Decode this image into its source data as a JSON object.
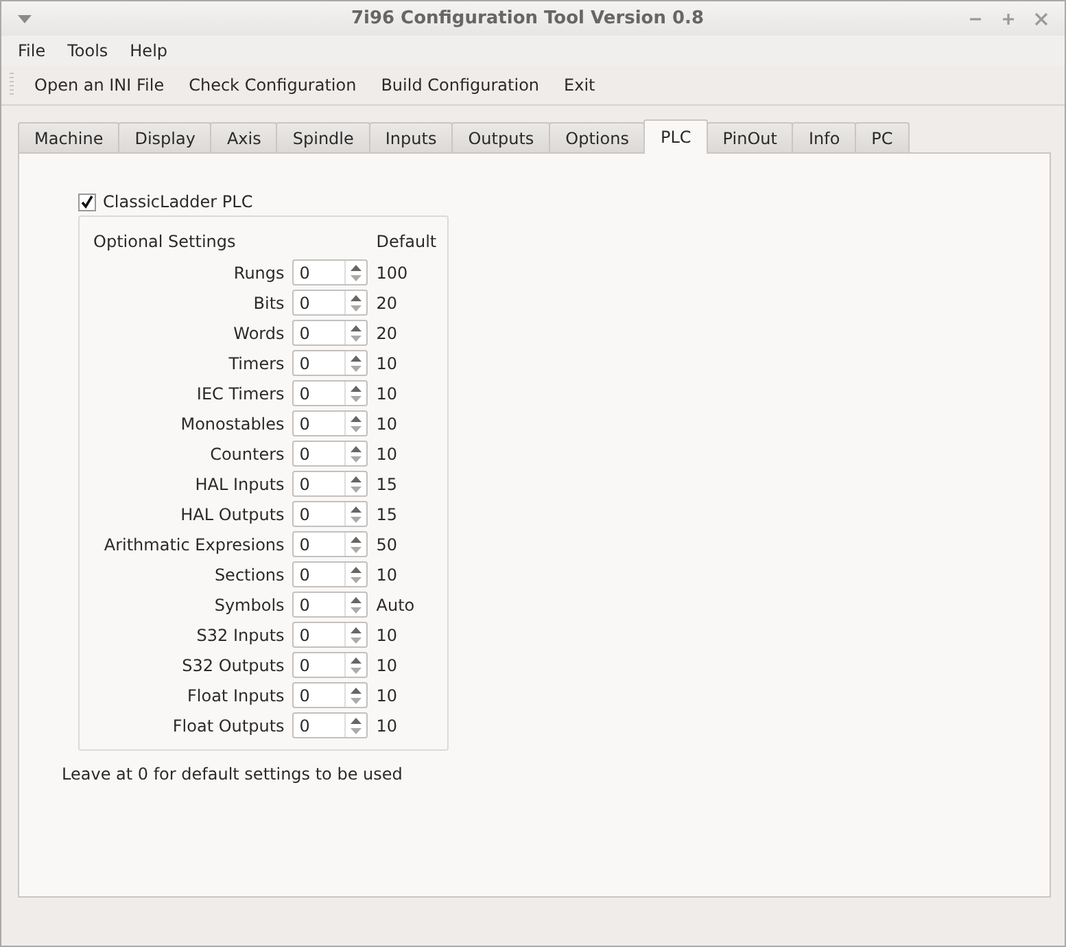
{
  "window": {
    "title": "7i96 Configuration Tool Version 0.8"
  },
  "menu": [
    "File",
    "Tools",
    "Help"
  ],
  "toolbar": [
    "Open an INI File",
    "Check Configuration",
    "Build Configuration",
    "Exit"
  ],
  "tabs": [
    {
      "label": "Machine",
      "selected": false
    },
    {
      "label": "Display",
      "selected": false
    },
    {
      "label": "Axis",
      "selected": false
    },
    {
      "label": "Spindle",
      "selected": false
    },
    {
      "label": "Inputs",
      "selected": false
    },
    {
      "label": "Outputs",
      "selected": false
    },
    {
      "label": "Options",
      "selected": false
    },
    {
      "label": "PLC",
      "selected": true
    },
    {
      "label": "PinOut",
      "selected": false
    },
    {
      "label": "Info",
      "selected": false
    },
    {
      "label": "PC",
      "selected": false
    }
  ],
  "plc": {
    "enable": {
      "label": "ClassicLadder PLC",
      "checked": true
    },
    "group": {
      "heading": "Optional Settings",
      "default_heading": "Default",
      "settings": [
        {
          "label": "Rungs",
          "value": "0",
          "default": "100"
        },
        {
          "label": "Bits",
          "value": "0",
          "default": "20"
        },
        {
          "label": "Words",
          "value": "0",
          "default": "20"
        },
        {
          "label": "Timers",
          "value": "0",
          "default": "10"
        },
        {
          "label": "IEC Timers",
          "value": "0",
          "default": "10"
        },
        {
          "label": "Monostables",
          "value": "0",
          "default": "10"
        },
        {
          "label": "Counters",
          "value": "0",
          "default": "10"
        },
        {
          "label": "HAL Inputs",
          "value": "0",
          "default": "15"
        },
        {
          "label": "HAL Outputs",
          "value": "0",
          "default": "15"
        },
        {
          "label": "Arithmatic Expresions",
          "value": "0",
          "default": "50"
        },
        {
          "label": "Sections",
          "value": "0",
          "default": "10"
        },
        {
          "label": "Symbols",
          "value": "0",
          "default": "Auto"
        },
        {
          "label": "S32 Inputs",
          "value": "0",
          "default": "10"
        },
        {
          "label": "S32 Outputs",
          "value": "0",
          "default": "10"
        },
        {
          "label": "Float Inputs",
          "value": "0",
          "default": "10"
        },
        {
          "label": "Float Outputs",
          "value": "0",
          "default": "10"
        }
      ]
    },
    "note": "Leave at 0 for default settings to be used"
  }
}
